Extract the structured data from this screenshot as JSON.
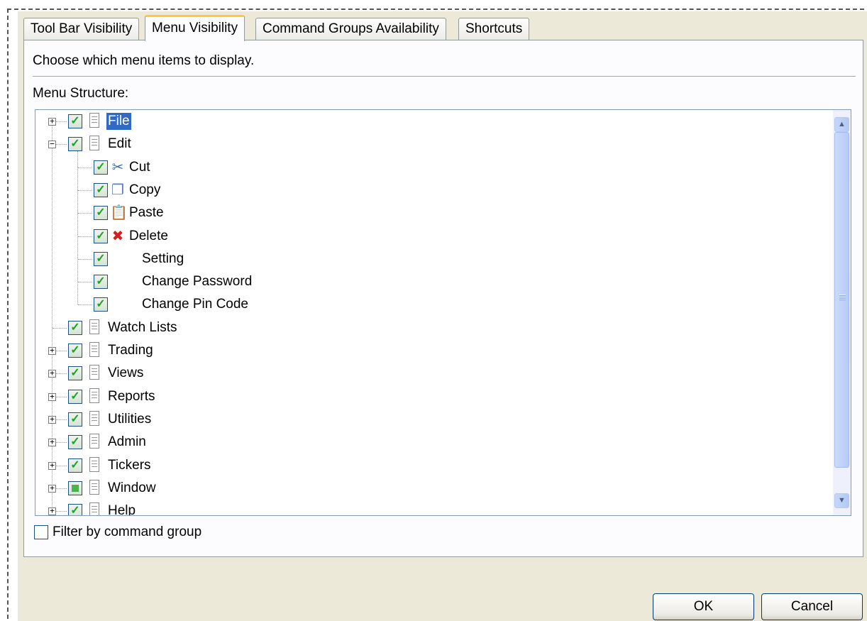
{
  "tabs": [
    {
      "label": "Tool Bar Visibility"
    },
    {
      "label": "Menu Visibility"
    },
    {
      "label": "Command Groups Availability"
    },
    {
      "label": "Shortcuts"
    }
  ],
  "active_tab": "Menu Visibility",
  "instruction": "Choose which menu items to display.",
  "tree_label": "Menu Structure:",
  "tree": {
    "items": [
      {
        "label": "File",
        "level": 0,
        "expander": "+",
        "checked": true,
        "icon": "document-icon",
        "selected": true
      },
      {
        "label": "Edit",
        "level": 0,
        "expander": "-",
        "checked": true,
        "icon": "document-icon"
      },
      {
        "label": "Cut",
        "level": 1,
        "checked": true,
        "icon": "scissors-icon"
      },
      {
        "label": "Copy",
        "level": 1,
        "checked": true,
        "icon": "copy-icon"
      },
      {
        "label": "Paste",
        "level": 1,
        "checked": true,
        "icon": "paste-icon"
      },
      {
        "label": "Delete",
        "level": 1,
        "checked": true,
        "icon": "delete-x-icon"
      },
      {
        "label": "Setting",
        "level": 1,
        "checked": true,
        "icon": ""
      },
      {
        "label": "Change Password",
        "level": 1,
        "checked": true,
        "icon": ""
      },
      {
        "label": "Change Pin Code",
        "level": 1,
        "checked": true,
        "icon": ""
      },
      {
        "label": "Watch Lists",
        "level": 0,
        "expander": "",
        "checked": true,
        "icon": "document-icon"
      },
      {
        "label": "Trading",
        "level": 0,
        "expander": "+",
        "checked": true,
        "icon": "document-icon"
      },
      {
        "label": "Views",
        "level": 0,
        "expander": "+",
        "checked": true,
        "icon": "document-icon"
      },
      {
        "label": "Reports",
        "level": 0,
        "expander": "+",
        "checked": true,
        "icon": "document-icon"
      },
      {
        "label": "Utilities",
        "level": 0,
        "expander": "+",
        "checked": true,
        "icon": "document-icon"
      },
      {
        "label": "Admin",
        "level": 0,
        "expander": "+",
        "checked": true,
        "icon": "document-icon"
      },
      {
        "label": "Tickers",
        "level": 0,
        "expander": "+",
        "checked": true,
        "icon": "document-icon"
      },
      {
        "label": "Window",
        "level": 0,
        "expander": "+",
        "checked": "partial",
        "icon": "document-icon"
      },
      {
        "label": "Help",
        "level": 0,
        "expander": "+",
        "checked": true,
        "icon": "document-icon"
      }
    ]
  },
  "filter": {
    "label": "Filter by command group",
    "checked": false
  },
  "buttons": {
    "ok": "OK",
    "cancel": "Cancel"
  }
}
